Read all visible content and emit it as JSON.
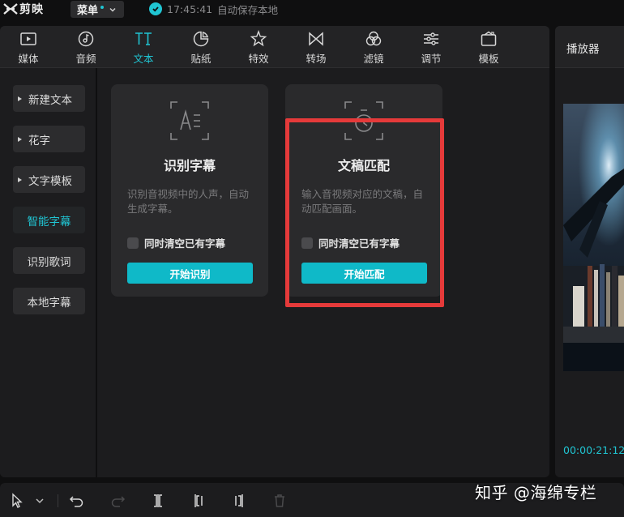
{
  "app": {
    "name": "剪映"
  },
  "menu": {
    "label": "菜单"
  },
  "save_status": {
    "time": "17:45:41",
    "text": "自动保存本地"
  },
  "toolbar": {
    "tabs": [
      {
        "label": "媒体",
        "icon": "media-icon"
      },
      {
        "label": "音频",
        "icon": "audio-icon"
      },
      {
        "label": "文本",
        "icon": "text-icon",
        "active": true
      },
      {
        "label": "贴纸",
        "icon": "sticker-icon"
      },
      {
        "label": "特效",
        "icon": "effects-icon"
      },
      {
        "label": "转场",
        "icon": "transition-icon"
      },
      {
        "label": "滤镜",
        "icon": "filter-icon"
      },
      {
        "label": "调节",
        "icon": "adjust-icon"
      },
      {
        "label": "模板",
        "icon": "template-icon"
      }
    ]
  },
  "sidebar": {
    "items": [
      {
        "label": "新建文本",
        "expandable": true
      },
      {
        "label": "花字",
        "expandable": true
      },
      {
        "label": "文字模板",
        "expandable": true
      },
      {
        "label": "智能字幕",
        "active": true
      },
      {
        "label": "识别歌词"
      },
      {
        "label": "本地字幕"
      }
    ]
  },
  "cards": [
    {
      "title": "识别字幕",
      "desc": "识别音视频中的人声，自动生成字幕。",
      "checkbox_label": "同时清空已有字幕",
      "button_label": "开始识别",
      "icon": "subtitle-recognition-icon"
    },
    {
      "title": "文稿匹配",
      "desc": "输入音视频对应的文稿，自动匹配画面。",
      "checkbox_label": "同时清空已有字幕",
      "button_label": "开始匹配",
      "icon": "script-match-icon"
    }
  ],
  "player": {
    "title": "播放器",
    "timecode": "00:00:21:12"
  },
  "watermark": "知乎 @海绵专栏",
  "colors": {
    "accent": "#20c5d3",
    "button": "#0fb9c8",
    "highlight": "#e53a3a",
    "panel": "#1c1c1e",
    "bg": "#0f0f10"
  }
}
